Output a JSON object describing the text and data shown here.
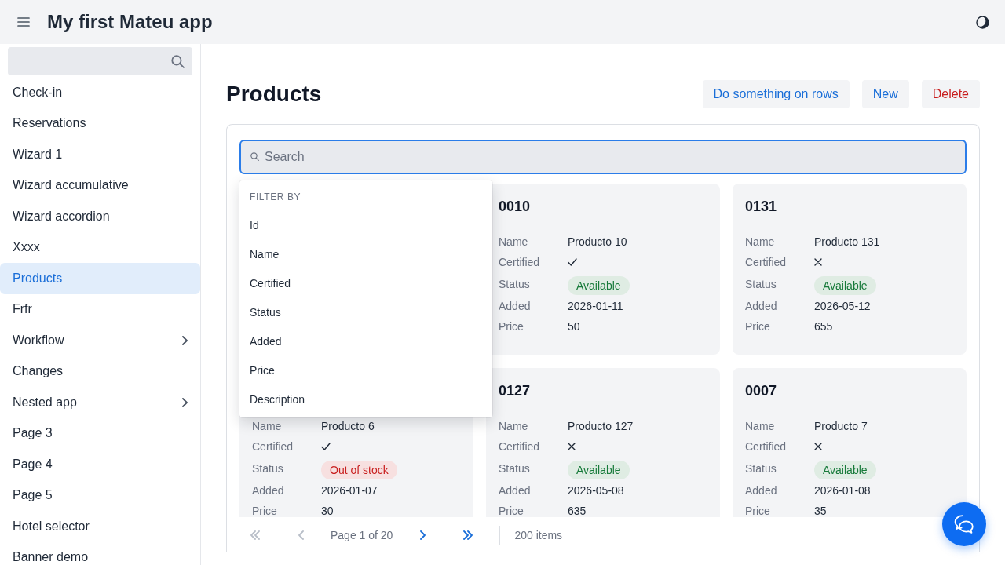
{
  "header": {
    "title": "My first Mateu app"
  },
  "sidebar": {
    "items": [
      {
        "label": "Check-in",
        "kind": "link",
        "selected": false
      },
      {
        "label": "Reservations",
        "kind": "link",
        "selected": false
      },
      {
        "label": "Wizard 1",
        "kind": "link",
        "selected": false
      },
      {
        "label": "Wizard accumulative",
        "kind": "link",
        "selected": false
      },
      {
        "label": "Wizard accordion",
        "kind": "link",
        "selected": false
      },
      {
        "label": "Xxxx",
        "kind": "link",
        "selected": false
      },
      {
        "label": "Products",
        "kind": "link",
        "selected": true
      },
      {
        "label": "Frfr",
        "kind": "link",
        "selected": false
      },
      {
        "label": "Workflow",
        "kind": "group",
        "selected": false
      },
      {
        "label": "Changes",
        "kind": "link",
        "selected": false
      },
      {
        "label": "Nested app",
        "kind": "group",
        "selected": false
      },
      {
        "label": "Page 3",
        "kind": "link",
        "selected": false
      },
      {
        "label": "Page 4",
        "kind": "link",
        "selected": false
      },
      {
        "label": "Page 5",
        "kind": "link",
        "selected": false
      },
      {
        "label": "Hotel selector",
        "kind": "link",
        "selected": false
      },
      {
        "label": "Banner demo",
        "kind": "link",
        "selected": false
      }
    ]
  },
  "page": {
    "title": "Products",
    "actions": [
      {
        "label": "Do something on rows",
        "kind": "primary"
      },
      {
        "label": "New",
        "kind": "primary"
      },
      {
        "label": "Delete",
        "kind": "danger"
      }
    ]
  },
  "search": {
    "placeholder": "Search",
    "focused": true
  },
  "filter_menu": {
    "heading": "FILTER BY",
    "items": [
      "Id",
      "Name",
      "Certified",
      "Status",
      "Added",
      "Price",
      "Description"
    ]
  },
  "cards": [
    {
      "id": "0010",
      "fields": [
        {
          "label": "Name",
          "kind": "text",
          "value": "Producto 10"
        },
        {
          "label": "Certified",
          "kind": "boolean",
          "checked": true
        },
        {
          "label": "Status",
          "kind": "status",
          "value": "Available",
          "color": "#177a3a"
        },
        {
          "label": "Added",
          "kind": "text",
          "value": "2026-01-11"
        },
        {
          "label": "Price",
          "kind": "text",
          "value": "50"
        }
      ]
    },
    {
      "id": "0131",
      "fields": [
        {
          "label": "Name",
          "kind": "text",
          "value": "Producto 131"
        },
        {
          "label": "Certified",
          "kind": "boolean",
          "checked": false
        },
        {
          "label": "Status",
          "kind": "status",
          "value": "Available",
          "color": "#177a3a"
        },
        {
          "label": "Added",
          "kind": "text",
          "value": "2026-05-12"
        },
        {
          "label": "Price",
          "kind": "text",
          "value": "655"
        }
      ]
    },
    {
      "fields": [
        {
          "label": "Name",
          "kind": "text",
          "value": "Producto 6"
        },
        {
          "label": "Certified",
          "kind": "boolean",
          "checked": true
        },
        {
          "label": "Status",
          "kind": "status",
          "value": "Out of stock",
          "color": "#c81e1e"
        },
        {
          "label": "Added",
          "kind": "text",
          "value": "2026-01-07"
        },
        {
          "label": "Price",
          "kind": "text",
          "value": "30"
        }
      ]
    },
    {
      "id": "0127",
      "fields": [
        {
          "label": "Name",
          "kind": "text",
          "value": "Producto 127"
        },
        {
          "label": "Certified",
          "kind": "boolean",
          "checked": false
        },
        {
          "label": "Status",
          "kind": "status",
          "value": "Available",
          "color": "#177a3a"
        },
        {
          "label": "Added",
          "kind": "text",
          "value": "2026-05-08"
        },
        {
          "label": "Price",
          "kind": "text",
          "value": "635"
        }
      ]
    },
    {
      "id": "0007",
      "fields": [
        {
          "label": "Name",
          "kind": "text",
          "value": "Producto 7"
        },
        {
          "label": "Certified",
          "kind": "boolean",
          "checked": false
        },
        {
          "label": "Status",
          "kind": "status",
          "value": "Available",
          "color": "#177a3a"
        },
        {
          "label": "Added",
          "kind": "text",
          "value": "2026-01-08"
        },
        {
          "label": "Price",
          "kind": "text",
          "value": "35"
        }
      ]
    }
  ],
  "pagination": {
    "controls": [
      {
        "kind": "first",
        "disabled": true
      },
      {
        "kind": "previous",
        "disabled": true
      },
      {
        "kind": "label",
        "text": "Page 1 of 20"
      },
      {
        "kind": "next",
        "disabled": false
      },
      {
        "kind": "last",
        "disabled": false
      }
    ],
    "total": "200 items"
  }
}
